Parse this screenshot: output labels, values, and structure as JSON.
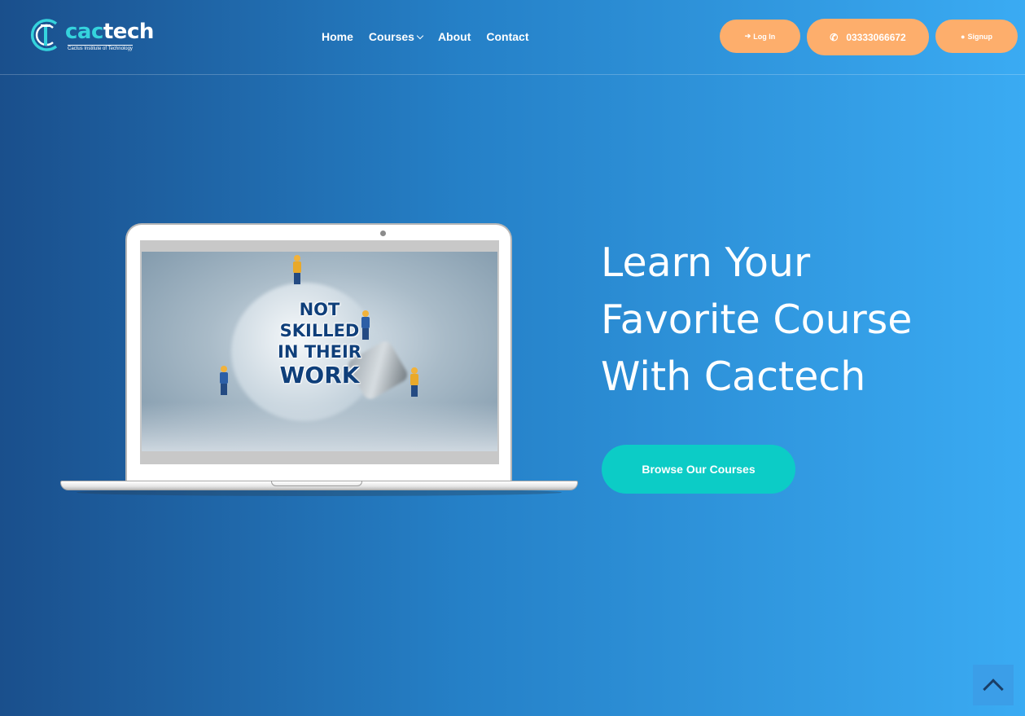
{
  "brand": {
    "name_part1": "cac",
    "name_part2": "tech",
    "tagline": "Cactus Institute of Technology",
    "colors": {
      "accent": "#35d3dd",
      "button_orange": "#fdae6c",
      "cta_teal": "#0cccc6"
    }
  },
  "nav": {
    "links": [
      {
        "label": "Home"
      },
      {
        "label": "Courses",
        "icon": "chevron-down-icon"
      },
      {
        "label": "About"
      },
      {
        "label": "Contact"
      }
    ]
  },
  "header_buttons": {
    "login": {
      "label": "Log In",
      "icon": "sign-in-icon"
    },
    "phone": {
      "label": "03333066672",
      "icon": "phone-icon"
    },
    "signup": {
      "label": "Signup",
      "icon": "user-icon"
    }
  },
  "hero": {
    "screen_text": [
      "NOT",
      "SKILLED",
      "IN THEIR",
      "WORK"
    ],
    "headline": [
      "Learn Your",
      "Favorite Course",
      "With Cactech"
    ],
    "cta_label": "Browse Our Courses"
  },
  "scroll_top": {
    "icon": "chevron-up-icon"
  }
}
